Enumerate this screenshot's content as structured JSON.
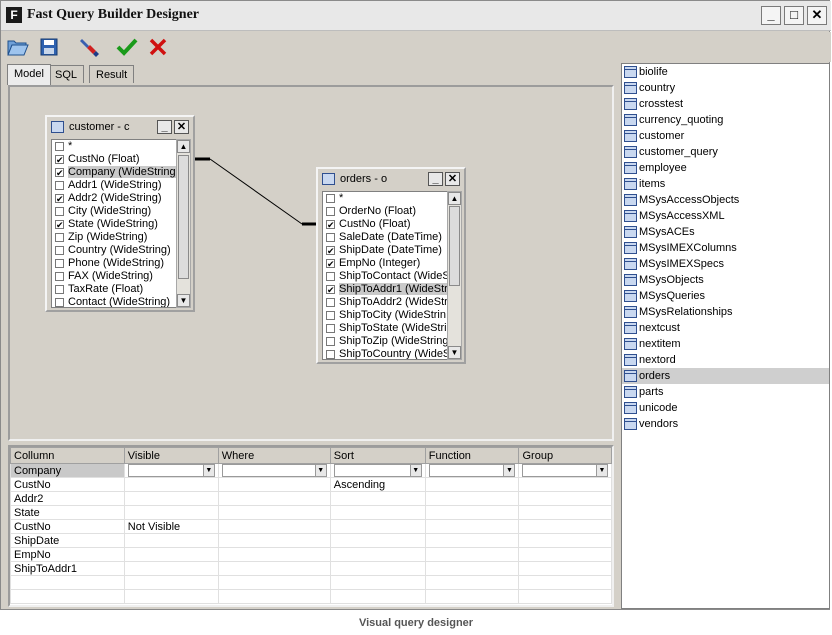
{
  "window": {
    "title": "Fast Query Builder  Designer",
    "app_icon_letter": "F",
    "controls": [
      "minimize-icon",
      "maximize-icon",
      "close-icon"
    ]
  },
  "toolbar": {
    "buttons": [
      {
        "name": "open-button",
        "icon": "folder-open-icon"
      },
      {
        "name": "save-button",
        "icon": "save-disk-icon"
      },
      {
        "name": "clear-button",
        "icon": "brush-icon"
      },
      {
        "name": "ok-button",
        "icon": "checkmark-icon",
        "color": "#1a9a1a"
      },
      {
        "name": "cancel-button",
        "icon": "x-mark-icon",
        "color": "#d01010"
      }
    ]
  },
  "tabs": [
    {
      "label": "Model",
      "active": true
    },
    {
      "label": "SQL",
      "active": false
    },
    {
      "label": "Result",
      "active": false
    }
  ],
  "tables": [
    {
      "title": "customer - c",
      "fields": [
        {
          "label": "*",
          "checked": false
        },
        {
          "label": "CustNo (Float)",
          "checked": true
        },
        {
          "label": "Company (WideString",
          "checked": true,
          "selected": true
        },
        {
          "label": "Addr1 (WideString)",
          "checked": false
        },
        {
          "label": "Addr2 (WideString)",
          "checked": true
        },
        {
          "label": "City (WideString)",
          "checked": false
        },
        {
          "label": "State (WideString)",
          "checked": true
        },
        {
          "label": "Zip (WideString)",
          "checked": false
        },
        {
          "label": "Country (WideString)",
          "checked": false
        },
        {
          "label": "Phone (WideString)",
          "checked": false
        },
        {
          "label": "FAX (WideString)",
          "checked": false
        },
        {
          "label": "TaxRate (Float)",
          "checked": false
        },
        {
          "label": "Contact (WideString)",
          "checked": false
        }
      ]
    },
    {
      "title": "orders - o",
      "fields": [
        {
          "label": "*",
          "checked": false
        },
        {
          "label": "OrderNo (Float)",
          "checked": false
        },
        {
          "label": "CustNo (Float)",
          "checked": true
        },
        {
          "label": "SaleDate (DateTime)",
          "checked": false
        },
        {
          "label": "ShipDate (DateTime)",
          "checked": true
        },
        {
          "label": "EmpNo (Integer)",
          "checked": true
        },
        {
          "label": "ShipToContact (WideS",
          "checked": false
        },
        {
          "label": "ShipToAddr1 (WideStr",
          "checked": true,
          "selected": true
        },
        {
          "label": "ShipToAddr2 (WideStr",
          "checked": false
        },
        {
          "label": "ShipToCity (WideStrin",
          "checked": false
        },
        {
          "label": "ShipToState (WideStri",
          "checked": false
        },
        {
          "label": "ShipToZip (WideString",
          "checked": false
        },
        {
          "label": "ShipToCountry (WideS",
          "checked": false
        }
      ]
    }
  ],
  "grid": {
    "headers": [
      "Collumn",
      "Visible",
      "Where",
      "Sort",
      "Function",
      "Group"
    ],
    "rows": [
      [
        "Company",
        "",
        "",
        "",
        "",
        ""
      ],
      [
        "CustNo",
        "",
        "",
        "Ascending",
        "",
        ""
      ],
      [
        "Addr2",
        "",
        "",
        "",
        "",
        ""
      ],
      [
        "State",
        "",
        "",
        "",
        "",
        ""
      ],
      [
        "CustNo",
        "Not Visible",
        "",
        "",
        "",
        ""
      ],
      [
        "ShipDate",
        "",
        "",
        "",
        "",
        ""
      ],
      [
        "EmpNo",
        "",
        "",
        "",
        "",
        ""
      ],
      [
        "ShipToAddr1",
        "",
        "",
        "",
        "",
        ""
      ],
      [
        "",
        "",
        "",
        "",
        "",
        ""
      ],
      [
        "",
        "",
        "",
        "",
        "",
        ""
      ]
    ]
  },
  "table_list": {
    "items": [
      "biolife",
      "country",
      "crosstest",
      "currency_quoting",
      "customer",
      "customer_query",
      "employee",
      "items",
      "MSysAccessObjects",
      "MSysAccessXML",
      "MSysACEs",
      "MSysIMEXColumns",
      "MSysIMEXSpecs",
      "MSysObjects",
      "MSysQueries",
      "MSysRelationships",
      "nextcust",
      "nextitem",
      "nextord",
      "orders",
      "parts",
      "unicode",
      "vendors"
    ],
    "selected": "orders"
  },
  "caption": "Visual query designer"
}
